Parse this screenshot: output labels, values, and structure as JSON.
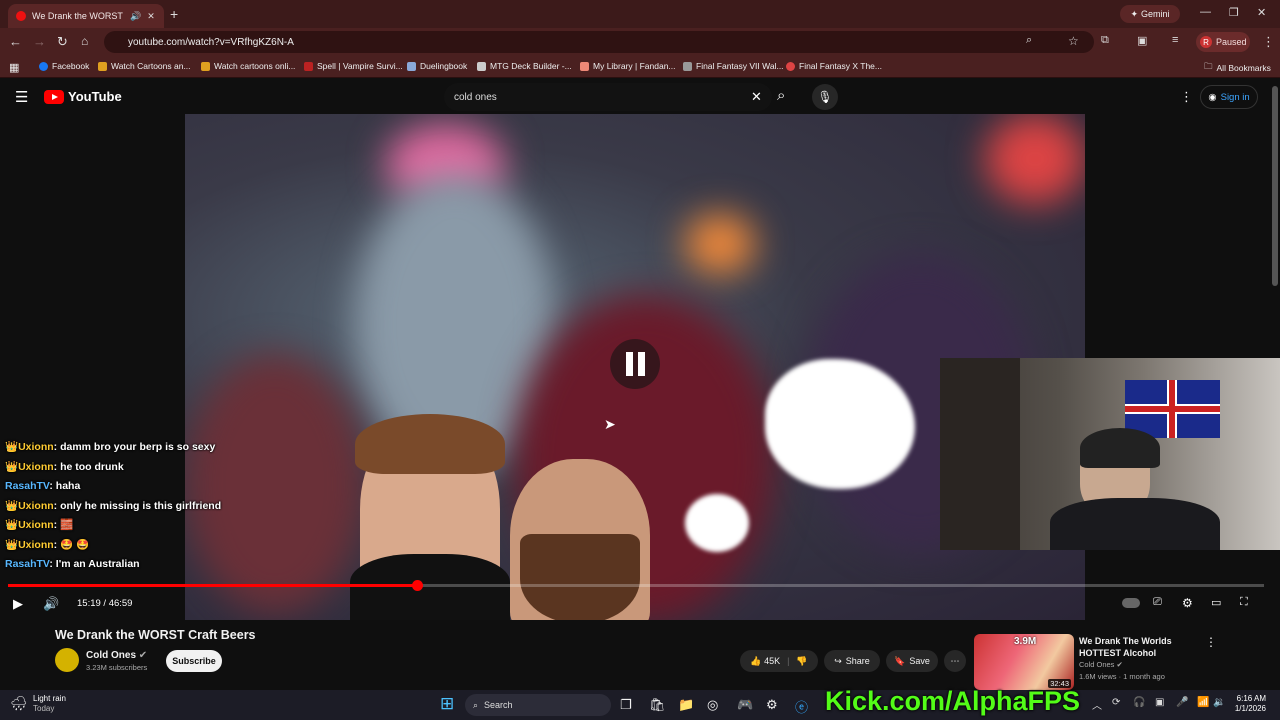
{
  "browser": {
    "tab_title": "We Drank the WORST Craft",
    "new_tab": "+",
    "gemini_label": "Gemini",
    "url": "youtube.com/watch?v=VRfhgKZ6N-A",
    "profile_initial": "R",
    "profile_status": "Paused",
    "bookmarks": [
      {
        "label": "Facebook",
        "color": "#1877f2"
      },
      {
        "label": "Watch Cartoons an...",
        "color": "#e0a020"
      },
      {
        "label": "Watch cartoons onli...",
        "color": "#e0a020"
      },
      {
        "label": "Spell | Vampire Survi...",
        "color": "#b22"
      },
      {
        "label": "Duelingbook",
        "color": "#8aa8d8"
      },
      {
        "label": "MTG Deck Builder -...",
        "color": "#ccc"
      },
      {
        "label": "My Library | Fandan...",
        "color": "#e87"
      },
      {
        "label": "Final Fantasy VII Wal...",
        "color": "#999"
      },
      {
        "label": "Final Fantasy X The...",
        "color": "#d44"
      }
    ],
    "all_bookmarks": "All Bookmarks"
  },
  "youtube": {
    "logo_text": "YouTube",
    "search_value": "cold ones",
    "sign_in": "Sign in"
  },
  "player": {
    "time": "15:19 / 46:59",
    "progress_fraction": 0.326
  },
  "chat": [
    {
      "user": "Uxionn",
      "crown": true,
      "text": "damm bro your berp is so sexy"
    },
    {
      "user": "Uxionn",
      "crown": true,
      "text": "he too drunk"
    },
    {
      "user": "RasahTV",
      "crown": false,
      "text": "haha"
    },
    {
      "user": "Uxionn",
      "crown": true,
      "text": "only he missing is this girlfriend"
    },
    {
      "user": "Uxionn",
      "crown": true,
      "text": "🧱"
    },
    {
      "user": "Uxionn",
      "crown": true,
      "text": "🤩 🤩"
    },
    {
      "user": "RasahTV",
      "crown": false,
      "text": "I'm an Australian"
    }
  ],
  "video_info": {
    "title": "We Drank the WORST Craft Beers",
    "channel": "Cold Ones",
    "subscribers": "3.23M subscribers",
    "subscribe": "Subscribe",
    "likes": "45K",
    "share": "Share",
    "save": "Save"
  },
  "recommended": {
    "title_line1": "We Drank The Worlds",
    "title_line2": "HOTTEST Alcohol",
    "channel": "Cold Ones",
    "meta": "1.6M views · 1 month ago",
    "duration": "32:43",
    "badge": "3.9M"
  },
  "overlay": {
    "kick_text": "Kick.com/AlphaFPS"
  },
  "taskbar": {
    "weather_title": "Light rain",
    "weather_sub": "Today",
    "search": "Search",
    "time": "6:16 AM",
    "date": "1/1/2026"
  }
}
